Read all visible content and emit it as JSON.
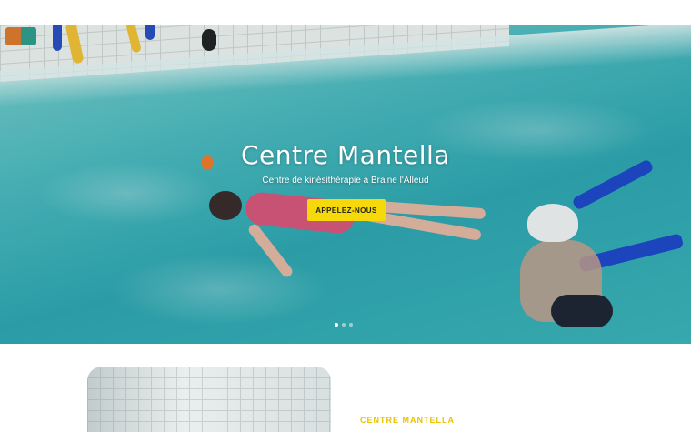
{
  "hero": {
    "title": "Centre Mantella",
    "subtitle": "Centre de kinésithérapie à Braine l'Alleud",
    "cta_label": "APPELEZ-NOUS",
    "slides_count": 3,
    "active_slide": 1
  },
  "section": {
    "heading": "CENTRE MANTELLA"
  },
  "colors": {
    "accent": "#f5d90a",
    "heading_accent": "#e8c400",
    "water": "#3cb3b8",
    "noodle_blue": "#1f47c9"
  },
  "icons": {
    "slider_dot": "dot"
  }
}
